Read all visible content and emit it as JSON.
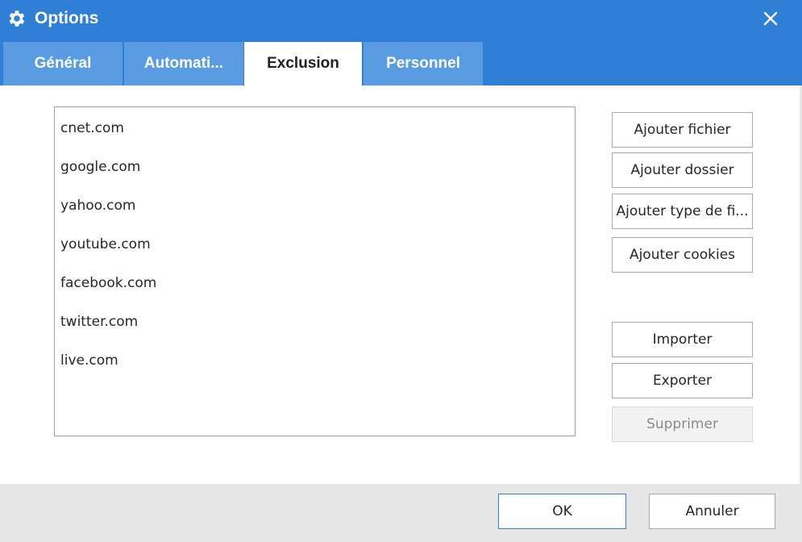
{
  "window": {
    "title": "Options",
    "title_icon": "gear-icon",
    "close_icon": "close-icon",
    "accent_color": "#2f7fd6"
  },
  "tabs": [
    {
      "label": "Général",
      "active": false
    },
    {
      "label": "Automati...",
      "active": false
    },
    {
      "label": "Exclusion",
      "active": true
    },
    {
      "label": "Personnel",
      "active": false
    }
  ],
  "exclusion_list": {
    "items": [
      "cnet.com",
      "google.com",
      "yahoo.com",
      "youtube.com",
      "facebook.com",
      "twitter.com",
      "live.com"
    ]
  },
  "side_buttons": {
    "add_file": "Ajouter fichier",
    "add_folder": "Ajouter dossier",
    "add_file_type": "Ajouter type de fi...",
    "add_cookies": "Ajouter cookies",
    "import": "Importer",
    "export": "Exporter",
    "delete": "Supprimer"
  },
  "footer": {
    "ok": "OK",
    "cancel": "Annuler"
  }
}
